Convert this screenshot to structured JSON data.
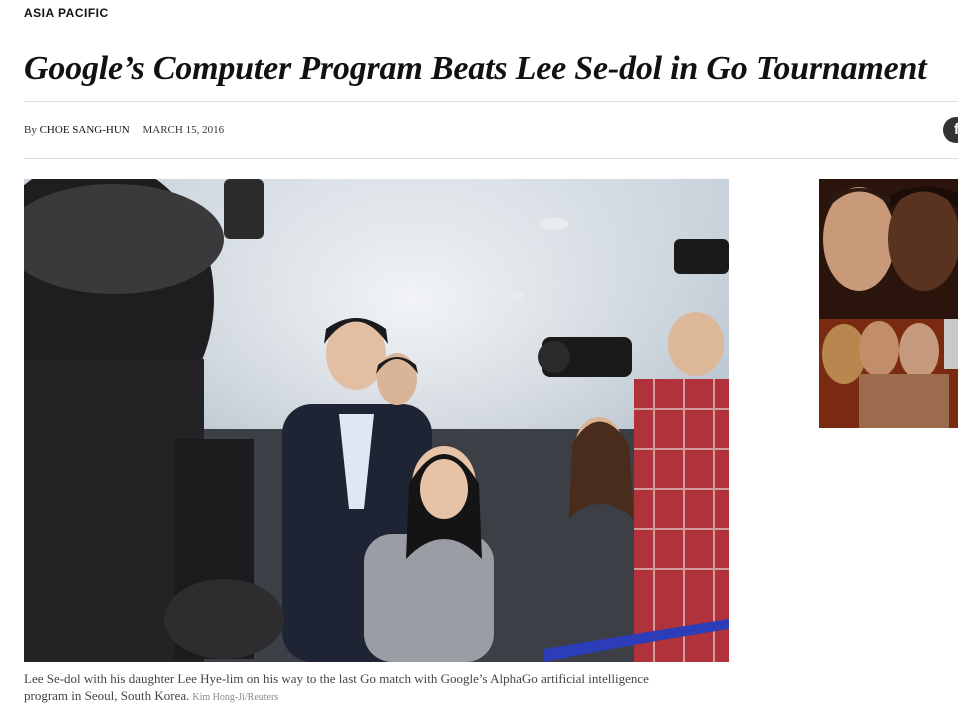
{
  "section": {
    "kicker": "ASIA PACIFIC"
  },
  "article": {
    "headline": "Google’s Computer Program Beats Lee Se-dol in Go Tournament",
    "byline_prefix": "By",
    "author": "CHOE SANG-HUN",
    "date": "MARCH 15, 2016"
  },
  "share": {
    "facebook_glyph": "f"
  },
  "photo": {
    "caption": "Lee Se-dol with his daughter Lee Hye-lim on his way to the last Go match with Google’s AlphaGo artificial intelligence program in Seoul, South Korea.",
    "credit": "Kim Hong-Ji/Reuters"
  },
  "icons": {
    "share": "facebook-icon"
  },
  "colors": {
    "text": "#111111",
    "rule": "#dcdcdc",
    "fb_button": "#333333"
  }
}
